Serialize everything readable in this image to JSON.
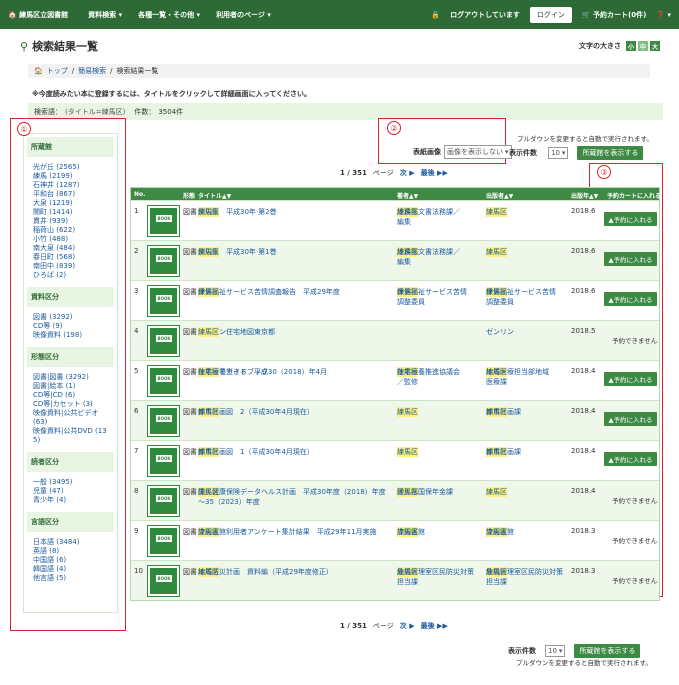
{
  "header": {
    "brand": "練馬区立図書館",
    "nav": [
      "資料検索 ▾",
      "各種一覧・その他 ▾",
      "利用者のページ ▾"
    ],
    "logout_status": "ログアウトしています",
    "login": "ログイン",
    "cart": "予約カート(0件)",
    "help": "❓ ▾"
  },
  "page": {
    "title": "検索結果一覧",
    "font_size_label": "文字の大きさ",
    "font_sizes": [
      "小",
      "中",
      "大"
    ],
    "breadcrumb": [
      "トップ",
      "/",
      "簡易検索",
      "/",
      "検索結果一覧"
    ],
    "notice": "※今度読みたい本に登録するには、タイトルをクリックして詳細画面に入ってください。",
    "condition_label": "検索語：",
    "condition_value": "(タイトル=練馬区)",
    "count_label": "件数：",
    "count_value": "3504件"
  },
  "facets": [
    {
      "title": "所蔵館",
      "items": [
        "光が丘 (2565)",
        "練馬 (2199)",
        "石神井 (1287)",
        "平和台 (867)",
        "大泉 (1219)",
        "関町 (1414)",
        "貫井 (939)",
        "稲荷山 (622)",
        "小竹 (488)",
        "南大泉 (484)",
        "春日町 (568)",
        "南田中 (839)",
        "ひろば (2)"
      ]
    },
    {
      "title": "資料区分",
      "items": [
        "図書 (3292)",
        "CD等 (9)",
        "映像資料 (198)"
      ]
    },
    {
      "title": "形態区分",
      "items": [
        "図書|図書 (3292)",
        "図書|絵本 (1)",
        "CD等|CD (6)",
        "CD等|カセット (3)",
        "映像資料|公共ビデオ (63)",
        "映像資料|公共DVD (13",
        "5)"
      ]
    },
    {
      "title": "読者区分",
      "items": [
        "一般 (3495)",
        "児童 (47)",
        "青少年 (4)"
      ]
    },
    {
      "title": "言語区分",
      "items": [
        "日本語 (3484)",
        "英語 (8)",
        "中国語 (6)",
        "韓国語 (4)",
        "他言語 (5)"
      ]
    }
  ],
  "controls": {
    "cover_label": "表紙画像",
    "cover_value": "画像を表示しない",
    "pulldown_note": "プルダウンを変更すると自動で実行されます。",
    "display_count_label": "表示件数",
    "display_count_value": "10",
    "holdings_button": "所蔵館を表示する"
  },
  "pager": {
    "page": "1 / 351",
    "page_suffix": "ページ",
    "next": "次 ▶",
    "last": "最後 ▶▶"
  },
  "annotations": [
    "①",
    "②",
    "③"
  ],
  "table": {
    "headers": [
      "No.",
      "形態",
      "タイトル▲▼",
      "著者▲▼",
      "出版者▲▼",
      "出版年▲▼",
      "予約カートに入れる"
    ],
    "cover_text": "BOOK",
    "rows": [
      {
        "no": "1",
        "form": "図書",
        "hl": "練馬区",
        "title": " 例規集　平成30年 第2巻",
        "title2": "",
        "auth_hl": "練馬区",
        "author": " 総務部文書法務課／",
        "author2": "編集",
        "pub_hl": "練馬区",
        "publisher": "",
        "publisher2": "",
        "year": "2018.6",
        "action": "▲予約に入れる"
      },
      {
        "no": "2",
        "form": "図書",
        "hl": "練馬区",
        "title": " 例規集　平成30年 第1巻",
        "title2": "",
        "auth_hl": "練馬区",
        "author": " 総務部文書法務課／",
        "author2": "編集",
        "pub_hl": "練馬区",
        "publisher": "",
        "publisher2": "",
        "year": "2018.6",
        "action": "▲予約に入れる"
      },
      {
        "no": "3",
        "form": "図書",
        "hl": "練馬区",
        "title": " 保健福祉サービス苦情調査報告　平成29年度",
        "title2": "",
        "auth_hl": "練馬区",
        "author": " 保健福祉サービス苦情",
        "author2": "調整委員",
        "pub_hl": "練馬区",
        "publisher": " 保健福祉サービス苦情",
        "publisher2": "調整委員",
        "year": "2018.6",
        "action": "▲予約に入れる"
      },
      {
        "no": "4",
        "form": "図書",
        "hl": "",
        "title": "ゼンリン住宅地図東京都 ",
        "title_hl_after": "練馬区",
        "title2": "",
        "auth_hl": "",
        "author": "",
        "author2": "",
        "pub_hl": "",
        "publisher": "ゼンリン",
        "publisher2": "",
        "year": "2018.5",
        "action": "予約できません"
      },
      {
        "no": "5",
        "form": "図書",
        "hl": "",
        "title": "わが家で生きる　平成30（2018）年4月 ",
        "title_hl_after": "練馬区",
        "title3": " 在宅療養ガイドブック",
        "title2": "",
        "auth_hl": "練馬区",
        "author": " 在宅療養推進協議会",
        "author2": "／監修",
        "pub_hl": "練馬区",
        "publisher": " 地域医療担当部地域",
        "publisher2": "医療課",
        "year": "2018.4",
        "action": "▲予約に入れる"
      },
      {
        "no": "6",
        "form": "図書",
        "hl": "練馬区",
        "title": " 都市計画図　2（平成30年4月現在）",
        "title2": "",
        "auth_hl": "練馬区",
        "author": "",
        "author2": "",
        "pub_hl": "練馬区",
        "publisher": " 都市計画課",
        "publisher2": "",
        "year": "2018.4",
        "action": "▲予約に入れる"
      },
      {
        "no": "7",
        "form": "図書",
        "hl": "練馬区",
        "title": " 都市計画図　1（平成30年4月現在）",
        "title2": "",
        "auth_hl": "練馬区",
        "author": "",
        "author2": "",
        "pub_hl": "練馬区",
        "publisher": " 都市計画課",
        "publisher2": "",
        "year": "2018.4",
        "action": "▲予約に入れる"
      },
      {
        "no": "8",
        "form": "図書",
        "hl": "練馬区",
        "title": " 国民健康保険データヘルス計画　平成30年度（2018）年度",
        "title2": "～35（2023）年度",
        "auth_hl": "練馬区",
        "author": " 区民部国保年金課",
        "author2": "",
        "pub_hl": "練馬区",
        "publisher": "",
        "publisher2": "",
        "year": "2018.4",
        "action": "予約できません"
      },
      {
        "no": "9",
        "form": "図書",
        "hl": "練馬区",
        "title": " 立図書館利用者アンケート集計結果　平成29年11月実施",
        "title2": "",
        "auth_hl": "練馬区",
        "author": " 立図書館",
        "author2": "",
        "pub_hl": "練馬区",
        "publisher": " 立図書館",
        "publisher2": "",
        "year": "2018.3",
        "action": "予約できません"
      },
      {
        "no": "10",
        "form": "図書",
        "hl": "練馬区",
        "title": " 地域防災計画　資料編（平成29年度修正）",
        "title2": "",
        "auth_hl": "練馬区",
        "author": " 危機管理室区民防災対策",
        "author2": "担当課",
        "pub_hl": "練馬区",
        "publisher": " 危機管理室区民防災対策",
        "publisher2": "担当課",
        "year": "2018.3",
        "action": "予約できません"
      }
    ]
  },
  "colors": {
    "brand_green": "#2d6a35",
    "button_green": "#3e8a45",
    "annotation_red": "#d9232f",
    "highlight": "#fff07a"
  }
}
